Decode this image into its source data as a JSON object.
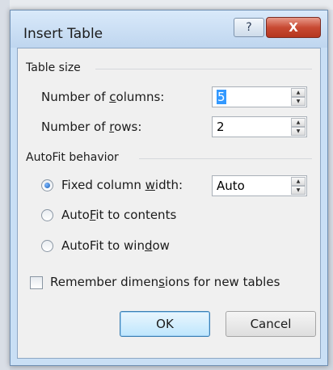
{
  "dialog": {
    "title": "Insert Table",
    "help_glyph": "?",
    "close_glyph": "X"
  },
  "table_size": {
    "heading": "Table size",
    "columns": {
      "label_pre": "Number of ",
      "label_mn": "c",
      "label_post": "olumns:",
      "value": "5"
    },
    "rows": {
      "label_pre": "Number of ",
      "label_mn": "r",
      "label_post": "ows:",
      "value": "2"
    }
  },
  "autofit": {
    "heading": "AutoFit behavior",
    "fixed": {
      "label_pre": "Fixed column ",
      "label_mn": "w",
      "label_post": "idth:",
      "value": "Auto",
      "selected": true
    },
    "contents": {
      "label_pre": "Auto",
      "label_mn": "F",
      "label_post": "it to contents",
      "selected": false
    },
    "window": {
      "label_pre": "AutoFit to win",
      "label_mn": "d",
      "label_post": "ow",
      "selected": false
    }
  },
  "remember": {
    "label_pre": "Remember dimen",
    "label_mn": "s",
    "label_post": "ions for new tables",
    "checked": false
  },
  "buttons": {
    "ok": "OK",
    "cancel": "Cancel"
  },
  "icons": {
    "help": "help-icon",
    "close": "close-icon",
    "spin_up": "spin-up-icon",
    "spin_down": "spin-down-icon"
  }
}
